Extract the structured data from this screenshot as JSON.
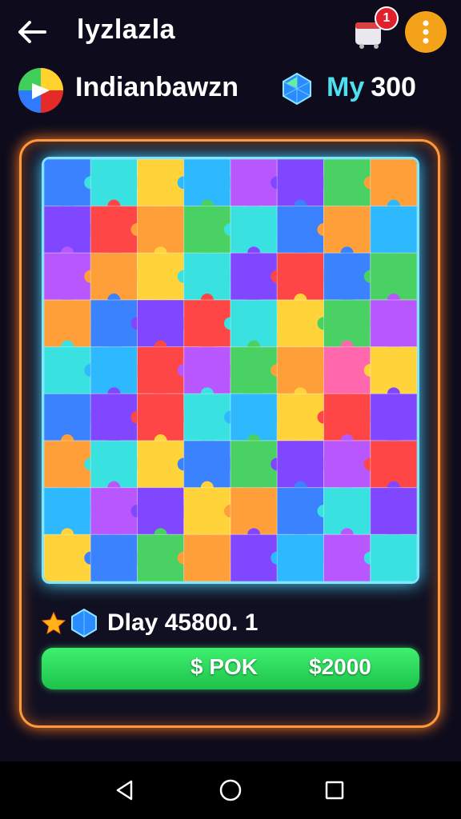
{
  "header": {
    "title": "lyzlazla",
    "cart_badge": "1"
  },
  "player": {
    "name": "Indianbawzn",
    "gem_label": "My",
    "gem_amount": "300"
  },
  "footer": {
    "info": "Dlay 45800. 1",
    "button_left": "$ POK",
    "button_right": "$2000"
  },
  "colors": {
    "accent_orange": "#ff9a3a",
    "board_glow": "#7fe6ff",
    "button_green": "#2fd85a",
    "menu_orange": "#f4a21a"
  },
  "icons": {
    "back": "arrow-left-icon",
    "cart": "shop-cart-icon",
    "menu": "more-vertical-icon",
    "gem": "gem-icon",
    "star": "star-icon",
    "nav_back": "triangle-back-icon",
    "nav_home": "circle-home-icon",
    "nav_recents": "square-recents-icon"
  },
  "puzzle": {
    "rows": 9,
    "cols": 8,
    "palette": [
      "#2f7bff",
      "#7a3cff",
      "#ff9a2e",
      "#ffd22e",
      "#2ee0e0",
      "#ff3b3b",
      "#3fcf5a",
      "#b54dff",
      "#ff5fa8",
      "#21b5ff"
    ],
    "grid": [
      [
        0,
        4,
        3,
        9,
        7,
        1,
        6,
        2
      ],
      [
        1,
        5,
        2,
        6,
        4,
        0,
        2,
        9
      ],
      [
        7,
        2,
        3,
        4,
        1,
        5,
        0,
        6
      ],
      [
        2,
        0,
        1,
        5,
        4,
        3,
        6,
        7
      ],
      [
        4,
        9,
        5,
        7,
        6,
        2,
        8,
        3
      ],
      [
        0,
        1,
        5,
        4,
        9,
        3,
        5,
        1
      ],
      [
        2,
        4,
        3,
        0,
        6,
        1,
        7,
        5
      ],
      [
        9,
        7,
        1,
        3,
        2,
        0,
        4,
        1
      ],
      [
        3,
        0,
        6,
        2,
        1,
        9,
        7,
        4
      ]
    ]
  }
}
